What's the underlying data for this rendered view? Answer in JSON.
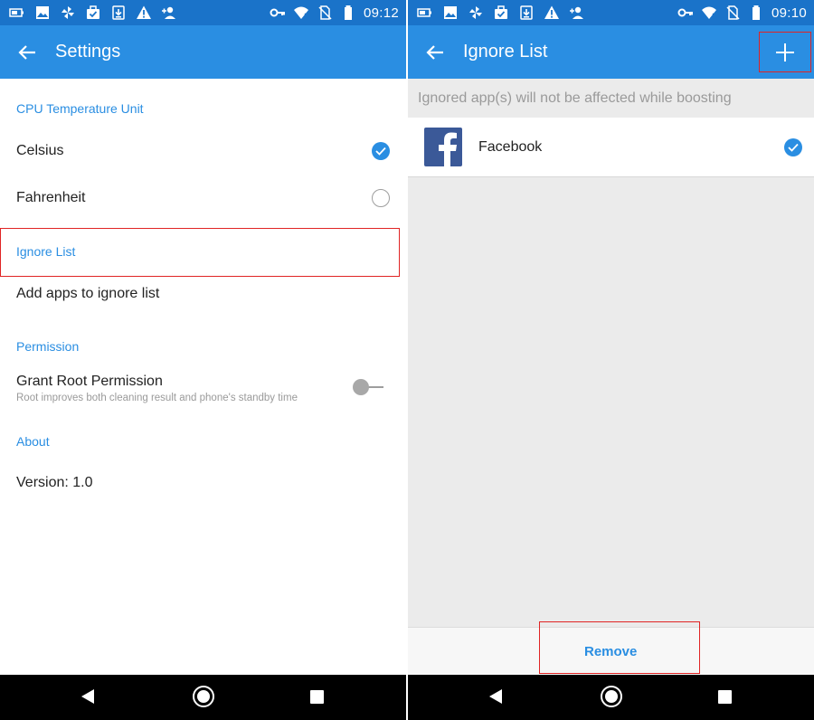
{
  "left_screen": {
    "status_bar": {
      "time": "09:12",
      "icons": [
        "battery-saver-icon",
        "image-icon",
        "pinwheel-icon",
        "briefcase-check-icon",
        "download-icon",
        "warning-icon",
        "person-add-icon",
        "key-icon",
        "wifi-icon",
        "no-sim-icon",
        "battery-icon"
      ]
    },
    "app_bar": {
      "title": "Settings",
      "back_icon": "arrow-left-icon"
    },
    "sections": {
      "cpu_temp": {
        "label": "CPU Temperature Unit",
        "options": [
          {
            "label": "Celsius",
            "selected": true
          },
          {
            "label": "Fahrenheit",
            "selected": false
          }
        ]
      },
      "ignore_list": {
        "label": "Ignore List",
        "item": "Add apps to ignore list"
      },
      "permission": {
        "label": "Permission",
        "item": "Grant Root Permission",
        "subtitle": "Root improves both cleaning result and phone's standby time",
        "toggle_on": false
      },
      "about": {
        "label": "About",
        "version": "Version: 1.0"
      }
    }
  },
  "right_screen": {
    "status_bar": {
      "time": "09:10",
      "icons": [
        "battery-saver-icon",
        "image-icon",
        "pinwheel-icon",
        "briefcase-check-icon",
        "download-icon",
        "warning-icon",
        "person-add-icon",
        "key-icon",
        "wifi-icon",
        "no-sim-icon",
        "battery-icon"
      ]
    },
    "app_bar": {
      "title": "Ignore List",
      "back_icon": "arrow-left-icon",
      "add_icon": "plus-icon"
    },
    "hint": "Ignored app(s) will not be affected while boosting",
    "apps": [
      {
        "name": "Facebook",
        "icon": "facebook-icon",
        "selected": true
      }
    ],
    "remove_label": "Remove"
  },
  "nav_bar": {
    "icons": [
      "back-triangle-icon",
      "home-circle-icon",
      "recents-square-icon"
    ]
  },
  "colors": {
    "accent": "#2a8ee2",
    "status_bar": "#1a73c9",
    "highlight_box": "#e02424",
    "facebook": "#3b5998"
  }
}
